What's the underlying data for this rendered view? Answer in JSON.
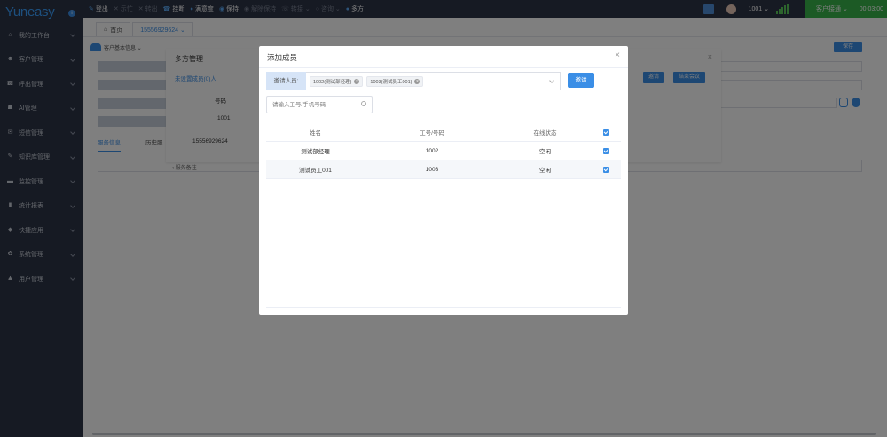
{
  "sidebar": {
    "logo": "Yuneasy",
    "logo_badge": "i",
    "items": [
      {
        "label": "我的工作台",
        "icon": "home-icon",
        "glyph": "⌂"
      },
      {
        "label": "客户管理",
        "icon": "users-icon",
        "glyph": "☻"
      },
      {
        "label": "呼出管理",
        "icon": "headset-icon",
        "glyph": "☎"
      },
      {
        "label": "AI管理",
        "icon": "robot-icon",
        "glyph": "☗"
      },
      {
        "label": "短信管理",
        "icon": "mail-icon",
        "glyph": "✉"
      },
      {
        "label": "知识库管理",
        "icon": "book-icon",
        "glyph": "✎"
      },
      {
        "label": "监控管理",
        "icon": "monitor-icon",
        "glyph": "▬"
      },
      {
        "label": "统计报表",
        "icon": "chart-icon",
        "glyph": "▮"
      },
      {
        "label": "快捷应用",
        "icon": "apps-icon",
        "glyph": "◆"
      },
      {
        "label": "系统管理",
        "icon": "gear-icon",
        "glyph": "✿"
      },
      {
        "label": "用户管理",
        "icon": "user-icon",
        "glyph": "♟"
      }
    ]
  },
  "topbar": {
    "buttons": [
      {
        "label": "登出",
        "glyph": "✎",
        "dim": false
      },
      {
        "label": "示忙",
        "glyph": "✕",
        "dim": true
      },
      {
        "label": "转出",
        "glyph": "✕",
        "dim": true
      },
      {
        "label": "挂断",
        "glyph": "☎",
        "dim": false
      },
      {
        "label": "满意度",
        "glyph": "♦",
        "dim": false
      },
      {
        "label": "保持",
        "glyph": "◉",
        "dim": false
      },
      {
        "label": "解除保持",
        "glyph": "◉",
        "dim": true
      },
      {
        "label": "转接 ⌄",
        "glyph": "☏",
        "dim": true
      },
      {
        "label": "咨询 ⌄",
        "glyph": "○",
        "dim": true
      },
      {
        "label": "多方",
        "glyph": "●",
        "dim": false
      }
    ],
    "extension": "1001 ⌄",
    "status": "客户接通 ⌄",
    "timer": "00:03:00"
  },
  "tabs": [
    {
      "label": "首页",
      "glyph": "⌂"
    },
    {
      "label": "15556929624 ⌄"
    }
  ],
  "content": {
    "info_label": "客户基本信息 ⌄",
    "save": "保存",
    "tab_service": "服务信息",
    "tab_history": "历史服",
    "sub": "‹ 服务备注"
  },
  "bg_dialog": {
    "title": "多方管理",
    "link": "未设置成员(0)人",
    "close": "×",
    "col_number": "号码",
    "row1": "1001",
    "row2": "15556929624",
    "btn_invite": "邀请",
    "btn_end": "结束会议"
  },
  "modal": {
    "title": "添加成员",
    "close": "×",
    "invite_label": "邀请人员:",
    "chips": [
      "1002(测试部经理)",
      "1003(测试员工001)"
    ],
    "invite_button": "邀请",
    "search_placeholder": "请输入工号/手机号码",
    "columns": [
      "姓名",
      "工号/号码",
      "在线状态"
    ],
    "rows": [
      {
        "name": "测试部经理",
        "number": "1002",
        "status": "空闲"
      },
      {
        "name": "测试员工001",
        "number": "1003",
        "status": "空闲"
      }
    ]
  }
}
